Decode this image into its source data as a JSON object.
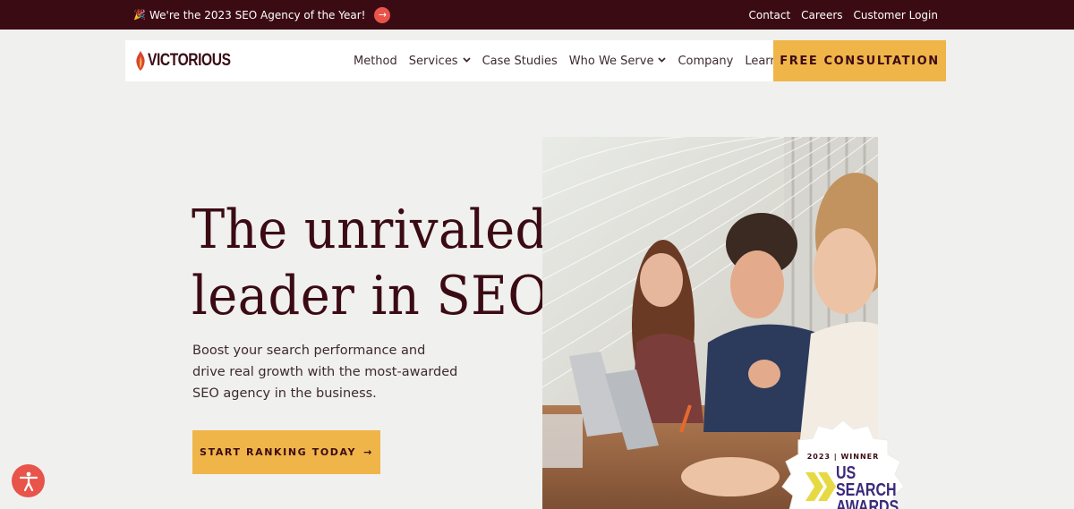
{
  "topbar": {
    "announcement": "We're the 2023 SEO Agency of the Year!",
    "party_icon": "party-popper-icon",
    "links": [
      "Contact",
      "Careers",
      "Customer Login"
    ]
  },
  "nav": {
    "logo_text": "VICTORIOUS",
    "items": [
      {
        "label": "Method",
        "dropdown": false
      },
      {
        "label": "Services",
        "dropdown": true
      },
      {
        "label": "Case Studies",
        "dropdown": false
      },
      {
        "label": "Who We Serve",
        "dropdown": true
      },
      {
        "label": "Company",
        "dropdown": false
      },
      {
        "label": "Learn",
        "dropdown": false
      }
    ],
    "cta": "FREE CONSULTATION"
  },
  "hero": {
    "headline_line1": "The unrivaled",
    "headline_line2": "leader in SEO.",
    "subtext": "Boost your search performance and drive real growth with the most-awarded SEO agency in the business.",
    "button": "START RANKING TODAY",
    "button_arrow": "→"
  },
  "badge": {
    "year_line": "2023 | WINNER",
    "title": "US\nSEARCH\nAWARDS"
  },
  "colors": {
    "maroon": "#3b0b14",
    "accent_yellow": "#f0b548",
    "accent_red": "#e8534a",
    "background": "#f0f0ee"
  }
}
